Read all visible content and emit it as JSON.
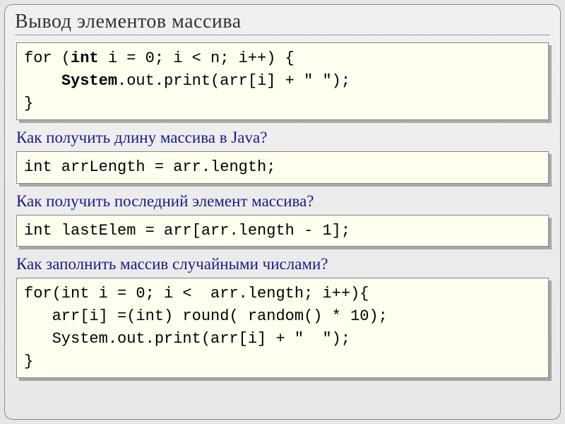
{
  "title": "Вывод элементов массива",
  "q1": "Как получить длину массива в Java?",
  "q2": "Как получить последний элемент массива?",
  "q3": "Как заполнить массив случайными  числами?",
  "code1_line1a": "for (",
  "code1_line1b": "int",
  "code1_line1c": " i = 0; i < n; i++) {",
  "code1_line2a": "    ",
  "code1_line2b": "System",
  "code1_line2c": ".out.print(arr[i] + \" \");",
  "code1_line3": "}",
  "code2": "int arrLength = arr.length;",
  "code3": "int lastElem = arr[arr.length - 1];",
  "code4_line1": "for(int i = 0; i <  arr.length; i++){",
  "code4_line2": "   arr[i] =(int) round( random() * 10);",
  "code4_line3": "   System.out.print(arr[i] + \"  \");",
  "code4_line4": "}"
}
